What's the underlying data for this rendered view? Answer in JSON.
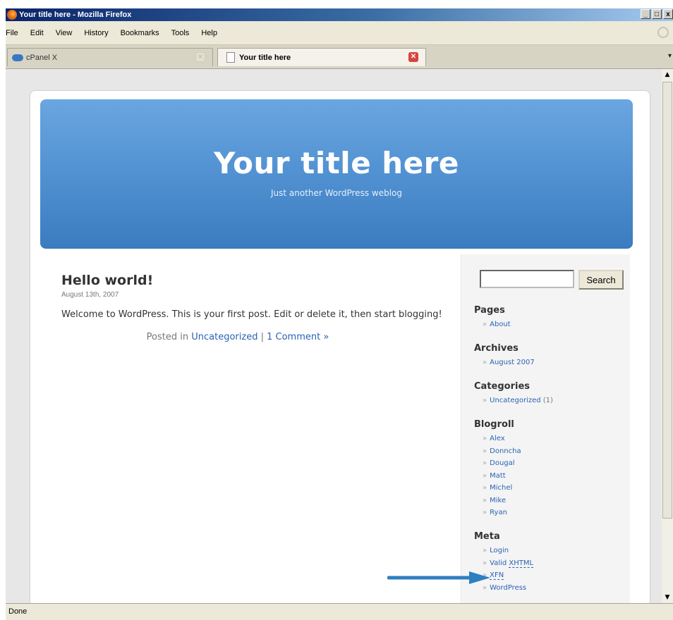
{
  "window": {
    "title": "Your title here - Mozilla Firefox",
    "controls": [
      "_",
      "□",
      "x"
    ]
  },
  "menu": [
    "File",
    "Edit",
    "View",
    "History",
    "Bookmarks",
    "Tools",
    "Help"
  ],
  "tabs": [
    {
      "label": "cPanel X",
      "active": false
    },
    {
      "label": "Your title here",
      "active": true
    }
  ],
  "tab_scroll_glyph": "▾",
  "scroll": {
    "up": "▲",
    "down": "▼"
  },
  "blog": {
    "title": "Your title here",
    "description": "Just another WordPress weblog"
  },
  "post": {
    "title": "Hello world!",
    "date": "August 13th, 2007",
    "body": "Welcome to WordPress. This is your first post. Edit or delete it, then start blogging!",
    "meta_prefix": "Posted in",
    "category": "Uncategorized",
    "separator": "|",
    "comments": "1 Comment »"
  },
  "sidebar": {
    "search_button": "Search",
    "search_value": "",
    "bullet": "»",
    "pages": {
      "title": "Pages",
      "items": [
        "About"
      ]
    },
    "archives": {
      "title": "Archives",
      "items": [
        "August 2007"
      ]
    },
    "categories": {
      "title": "Categories",
      "items": [
        {
          "label": "Uncategorized",
          "count": "(1)"
        }
      ]
    },
    "blogroll": {
      "title": "Blogroll",
      "items": [
        "Alex",
        "Donncha",
        "Dougal",
        "Matt",
        "Michel",
        "Mike",
        "Ryan"
      ]
    },
    "meta": {
      "title": "Meta",
      "items": [
        "Login",
        "Valid",
        "XHTML",
        "XFN",
        "WordPress"
      ]
    }
  },
  "status": "Done",
  "colors": {
    "header_top": "#6aa6e0",
    "header_bottom": "#3a7cbf",
    "link": "#2a62b4",
    "arrow": "#2f7fbf"
  }
}
